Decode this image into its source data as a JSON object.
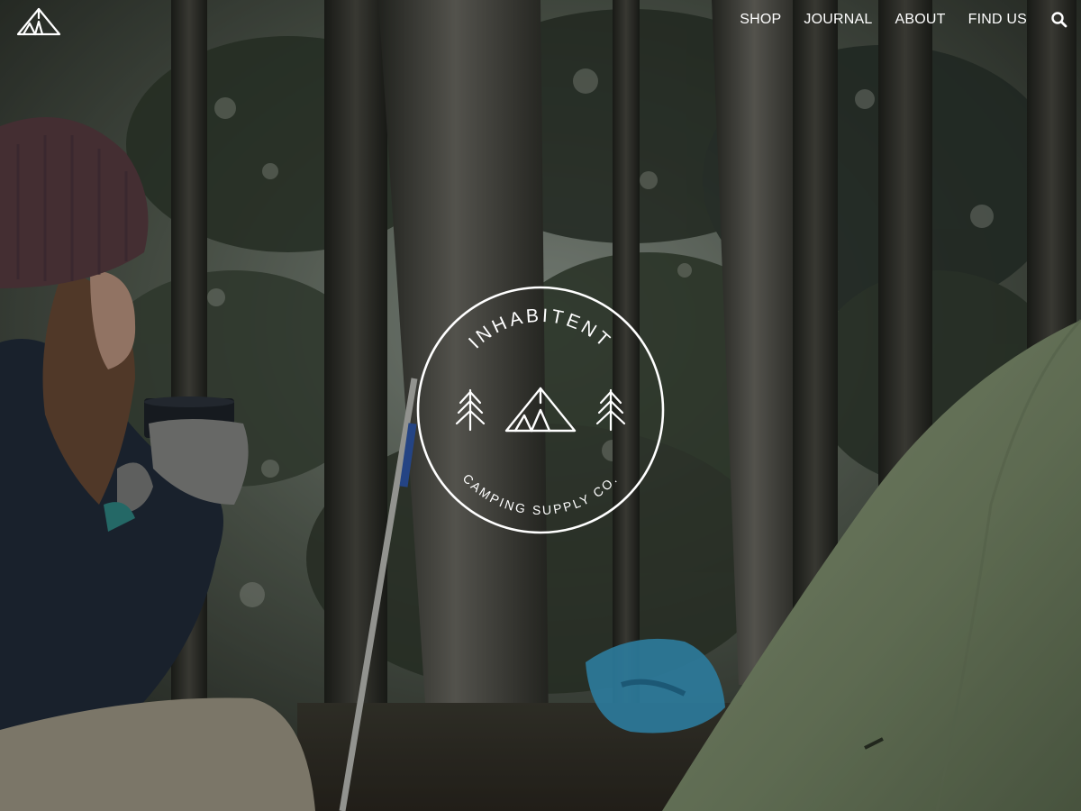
{
  "brand": {
    "logo_icon": "tent-logo-icon",
    "name": "INHABITENT",
    "tagline": "CAMPING SUPPLY CO."
  },
  "nav": {
    "items": [
      {
        "label": "SHOP"
      },
      {
        "label": "JOURNAL"
      },
      {
        "label": "ABOUT"
      },
      {
        "label": "FIND US"
      }
    ],
    "search_icon": "search-icon"
  },
  "hero": {
    "image": "forest-campsite-photo",
    "badge_icons": [
      "pine-tree-icon",
      "tent-icon",
      "pine-tree-icon"
    ]
  },
  "colors": {
    "text": "#ffffff",
    "tent": "#8a9c78",
    "jacket": "#1f2a3a",
    "beanie": "#5a3c42",
    "gear_blue": "#3aa7d6"
  }
}
